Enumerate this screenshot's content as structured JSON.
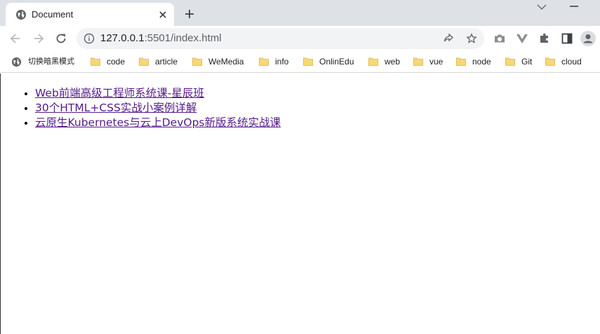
{
  "browser": {
    "tab": {
      "title": "Document",
      "favicon": "globe-icon"
    },
    "address": {
      "host": "127.0.0.1",
      "rest": ":5501/index.html"
    },
    "toolbar_icons": [
      "back-icon",
      "forward-icon",
      "reload-icon",
      "info-icon",
      "share-icon",
      "star-icon",
      "camera-icon",
      "vue-devtools-icon",
      "extensions-icon",
      "sidepanel-icon",
      "profile-icon"
    ]
  },
  "bookmarks": [
    {
      "label": "切换暗黑模式",
      "icon": "globe-icon"
    },
    {
      "label": "code",
      "icon": "folder-icon"
    },
    {
      "label": "article",
      "icon": "folder-icon"
    },
    {
      "label": "WeMedia",
      "icon": "folder-icon"
    },
    {
      "label": "info",
      "icon": "folder-icon"
    },
    {
      "label": "OnlinEdu",
      "icon": "folder-icon"
    },
    {
      "label": "web",
      "icon": "folder-icon"
    },
    {
      "label": "vue",
      "icon": "folder-icon"
    },
    {
      "label": "node",
      "icon": "folder-icon"
    },
    {
      "label": "Git",
      "icon": "folder-icon"
    },
    {
      "label": "cloud",
      "icon": "folder-icon"
    }
  ],
  "page": {
    "links": [
      "Web前端高级工程师系统课-星辰班",
      "30个HTML+CSS实战小案例详解",
      "云原生Kubernetes与云上DevOps新版系统实战课"
    ]
  },
  "colors": {
    "tabstrip": "#dee1e6",
    "omnibox": "#f1f3f4",
    "visited_link": "#551a8b",
    "folder": "#f8d775"
  }
}
